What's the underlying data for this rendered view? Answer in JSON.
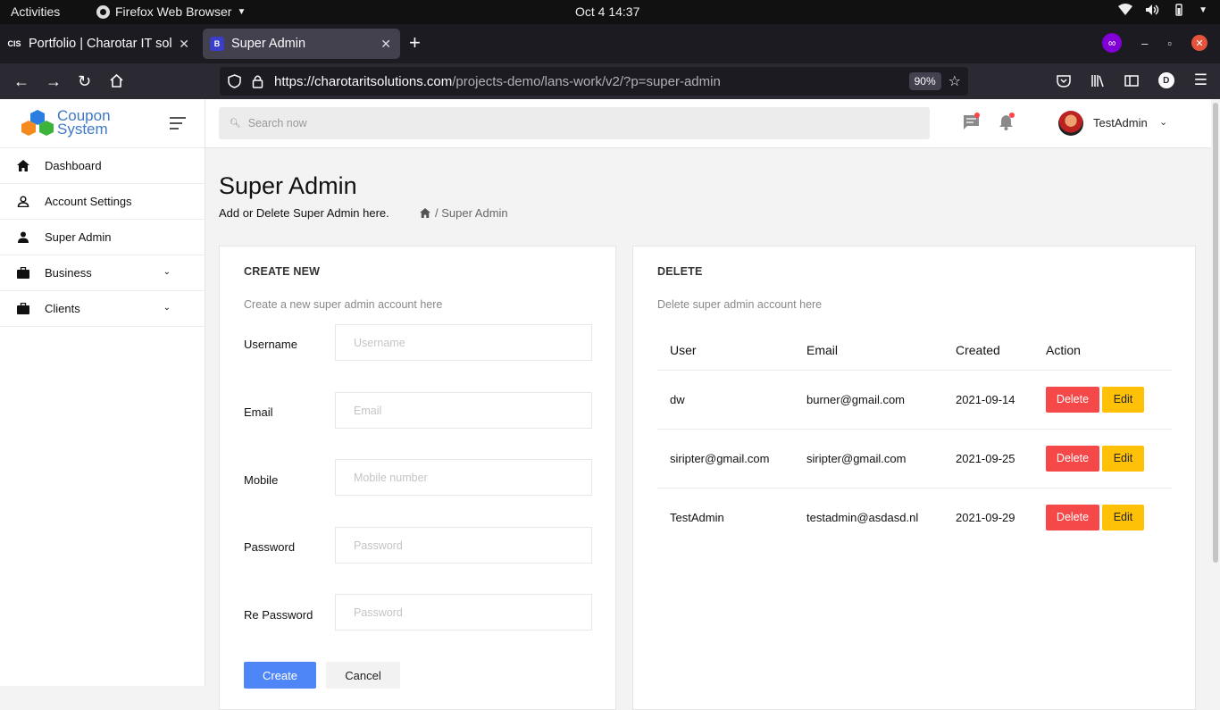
{
  "gnome": {
    "activities": "Activities",
    "app_name": "Firefox Web Browser",
    "clock": "Oct 4  14:37"
  },
  "browser": {
    "tabs": [
      {
        "favicon": "CIS",
        "title": "Portfolio | Charotar IT sol"
      },
      {
        "favicon": "B",
        "title": "Super Admin"
      }
    ],
    "url_host": "https://charotaritsolutions.com",
    "url_path": "/projects-demo/lans-work/v2/?p=super-admin",
    "zoom": "90%",
    "account_initial": "D"
  },
  "sidebar": {
    "logo_line1": "Coupon",
    "logo_line2": "System",
    "items": [
      {
        "label": "Dashboard",
        "icon": "home-icon"
      },
      {
        "label": "Account Settings",
        "icon": "user-outline-icon"
      },
      {
        "label": "Super Admin",
        "icon": "user-icon"
      },
      {
        "label": "Business",
        "icon": "briefcase-icon"
      },
      {
        "label": "Clients",
        "icon": "briefcase-icon"
      }
    ]
  },
  "header": {
    "search_placeholder": "Search now",
    "user_name": "TestAdmin"
  },
  "main": {
    "title": "Super Admin",
    "subtitle": "Add or Delete Super Admin here.",
    "breadcrumb": "/ Super Admin"
  },
  "create_card": {
    "title": "CREATE NEW",
    "description": "Create a new super admin account here",
    "fields": [
      {
        "label": "Username",
        "placeholder": "Username"
      },
      {
        "label": "Email",
        "placeholder": "Email"
      },
      {
        "label": "Mobile",
        "placeholder": "Mobile number"
      },
      {
        "label": "Password",
        "placeholder": "Password"
      },
      {
        "label": "Re Password",
        "placeholder": "Password"
      }
    ],
    "create_label": "Create",
    "cancel_label": "Cancel"
  },
  "delete_card": {
    "title": "DELETE",
    "description": "Delete super admin account here",
    "columns": [
      "User",
      "Email",
      "Created",
      "Action"
    ],
    "rows": [
      {
        "user": "dw",
        "email": "burner@gmail.com",
        "created": "2021-09-14"
      },
      {
        "user": "siripter@gmail.com",
        "email": "siripter@gmail.com",
        "created": "2021-09-25"
      },
      {
        "user": "TestAdmin",
        "email": "testadmin@asdasd.nl",
        "created": "2021-09-29"
      }
    ],
    "delete_label": "Delete",
    "edit_label": "Edit"
  },
  "colors": {
    "primary": "#4f86f7",
    "danger": "#f54848",
    "warning": "#ffc107",
    "logo_blue": "#3f78c3"
  }
}
